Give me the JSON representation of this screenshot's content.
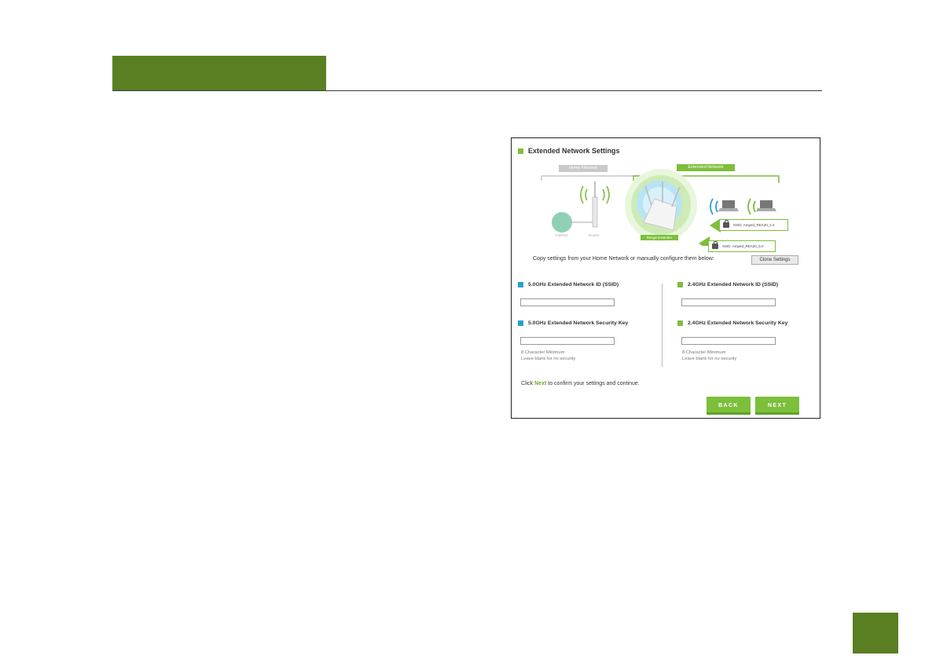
{
  "colors": {
    "brand_green": "#5a7f22",
    "accent_green": "#7cbf3b",
    "accent_blue": "#2a9fd0"
  },
  "screenshot": {
    "title": "Extended Network Settings",
    "diagram": {
      "home_network_label": "Home Network",
      "extended_network_label": "Extended Network",
      "internet_label": "Internet",
      "router_label": "Router",
      "range_extender_label": "Range Extender",
      "ssid_24_tag": "SSID: Amped_REA20_2.4",
      "ssid_50_tag": "SSID: Amped_REA20_5.0"
    },
    "copy_text": "Copy settings from your Home Network or manually configure them below:",
    "clone_button": "Clone Settings",
    "ssid_50_label": "5.0GHz Extended Network ID (SSID)",
    "ssid_24_label": "2.4GHz Extended Network ID (SSID)",
    "key_50_label": "5.0GHz Extended Network Security Key",
    "key_24_label": "2.4GHz Extended Network Security Key",
    "ssid_50_value": "",
    "ssid_24_value": "",
    "key_50_value": "",
    "key_24_value": "",
    "hint_line1": "8 Character Minimum",
    "hint_line2": "Leave blank for no security",
    "confirm_prefix": "Click",
    "confirm_next": "Next",
    "confirm_suffix": "to confirm your settings and continue.",
    "back_button": "BACK",
    "next_button": "NEXT"
  }
}
